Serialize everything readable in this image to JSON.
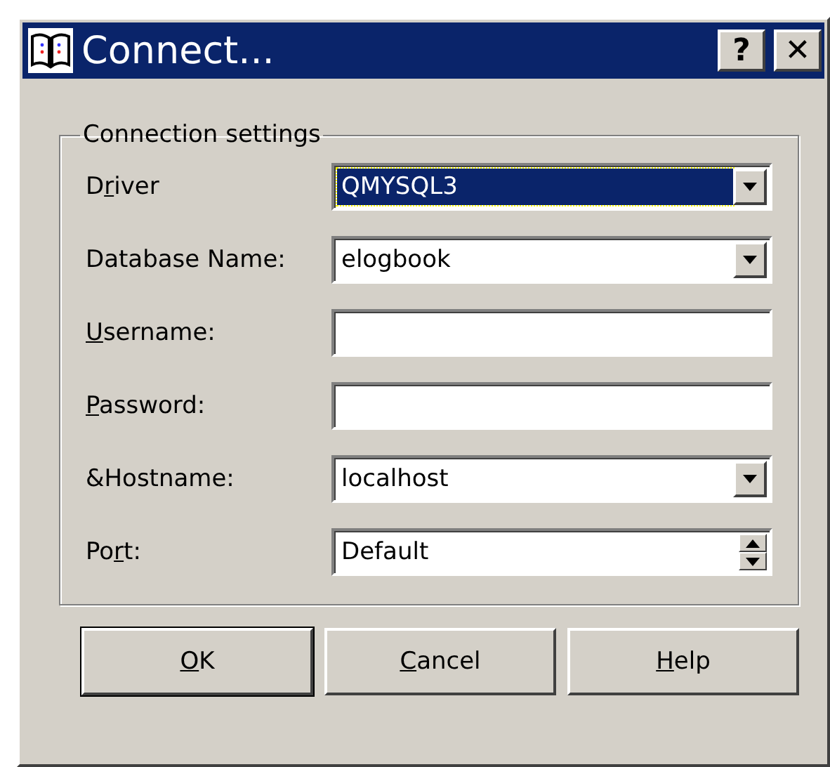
{
  "window": {
    "title": "Connect..."
  },
  "title_buttons": [
    {
      "label": "?"
    },
    {
      "label": "✕"
    }
  ],
  "group": {
    "title": "Connection settings"
  },
  "fields": [
    {
      "label": {
        "before": "D",
        "key": "r",
        "after": "iver"
      },
      "kind": "combo",
      "value": "QMYSQL3",
      "focused": true
    },
    {
      "label": {
        "before": "Database Name:"
      },
      "kind": "combo",
      "value": "elogbook",
      "focused": false
    },
    {
      "label": {
        "key": "U",
        "after": "sername:"
      },
      "kind": "text",
      "focused": false
    },
    {
      "label": {
        "key": "P",
        "after": "assword:"
      },
      "kind": "text",
      "focused": false
    },
    {
      "label": {
        "before": "&Hostname:"
      },
      "kind": "combo",
      "value": "localhost",
      "focused": false
    },
    {
      "label": {
        "before": "Po",
        "key": "r",
        "after": "t:"
      },
      "kind": "spin",
      "value": "Default",
      "focused": false
    }
  ],
  "buttons": [
    {
      "label": {
        "key": "O",
        "after": "K"
      },
      "default": true
    },
    {
      "label": {
        "key": "C",
        "after": "ancel"
      },
      "default": false
    },
    {
      "label": {
        "key": "H",
        "after": "elp"
      },
      "default": false
    }
  ]
}
